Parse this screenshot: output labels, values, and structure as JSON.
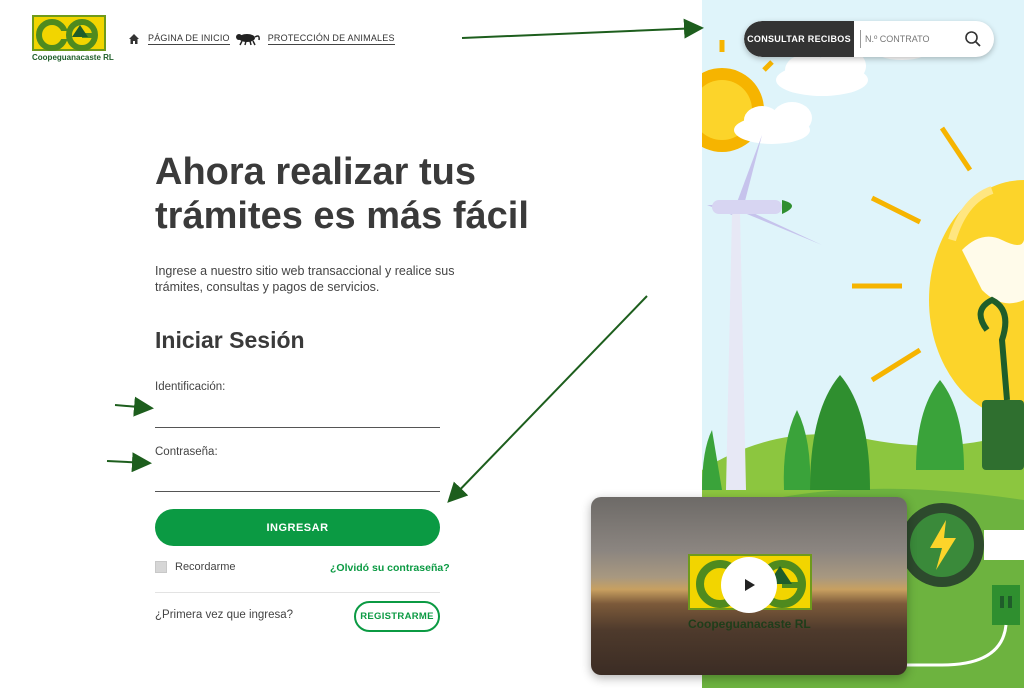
{
  "brand": {
    "name": "Coopeguanacaste RL",
    "mark": "CG",
    "green": "#0b9a43",
    "yellow": "#f2d500",
    "dark": "#333333"
  },
  "nav": {
    "home_icon": "home-icon",
    "home_label": "PÁGINA DE INICIO",
    "animal_icon": "monkey-icon",
    "animals_label": "PROTECCIÓN DE ANIMALES"
  },
  "topbar": {
    "receipts_label": "CONSULTAR RECIBOS",
    "contract_placeholder": "N.º CONTRATO",
    "search_icon": "search-icon"
  },
  "hero": {
    "title": "Ahora realizar tus trámites es más fácil",
    "subtitle": "Ingrese a nuestro sitio web transaccional y realice sus trámites, consultas y pagos de servicios."
  },
  "login": {
    "title": "Iniciar Sesión",
    "id_label": "Identificación:",
    "id_value": "",
    "password_label": "Contraseña:",
    "password_value": "",
    "submit_label": "INGRESAR",
    "remember_label": "Recordarme",
    "forgot_label": "¿Olvidó su contraseña?",
    "first_time_label": "¿Primera vez que ingresa?",
    "register_label": "REGISTRARME"
  },
  "video": {
    "logo_text": "Coopeguanacaste RL",
    "logo_mark": "CG",
    "play_icon": "play-icon"
  }
}
